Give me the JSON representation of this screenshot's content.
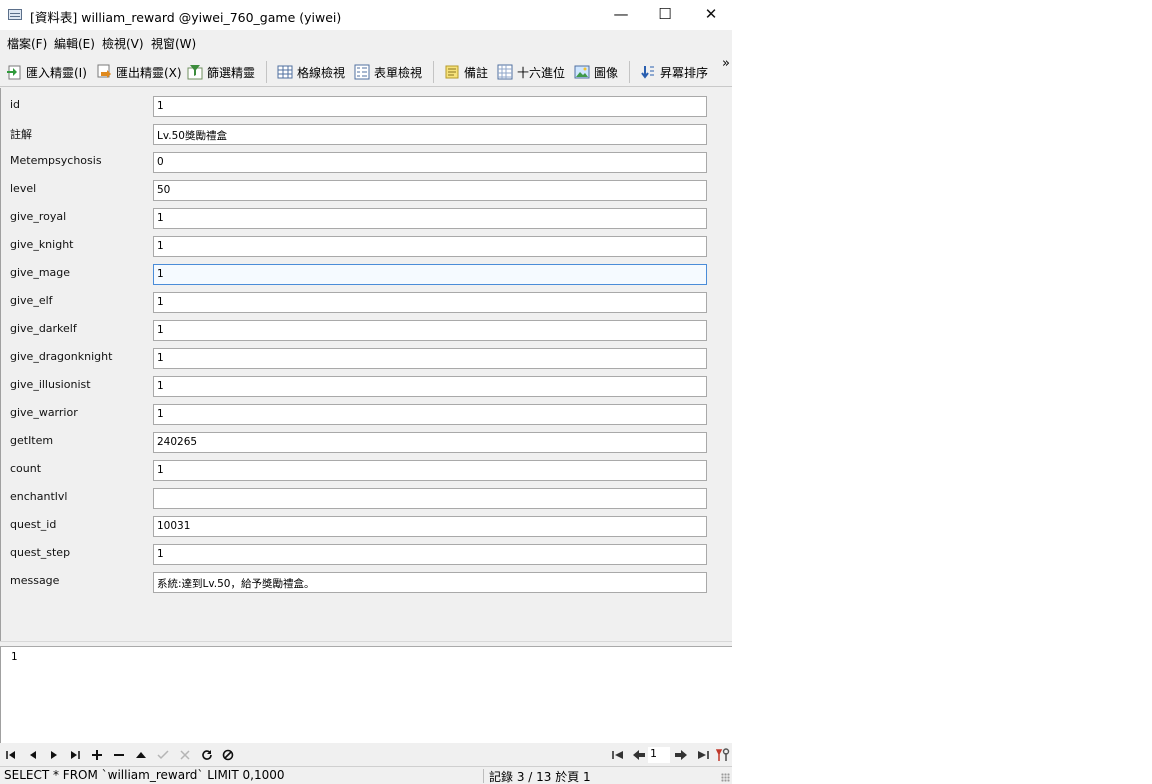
{
  "window": {
    "title": "[資料表] william_reward @yiwei_760_game (yiwei)",
    "buttons": {
      "minimize": "—",
      "maximize": "☐",
      "close": "✕"
    }
  },
  "menu": [
    {
      "label": "檔案(F)"
    },
    {
      "label": "編輯(E)"
    },
    {
      "label": "檢視(V)"
    },
    {
      "label": "視窗(W)"
    }
  ],
  "toolbar": {
    "import_wizard": "匯入精靈(I)",
    "export_wizard": "匯出精靈(X)",
    "filter_wizard": "篩選精靈",
    "grid_view": "格線檢視",
    "form_view": "表單檢視",
    "memo": "備註",
    "hex": "十六進位",
    "image": "圖像",
    "sort_asc": "昇冪排序",
    "more": "»"
  },
  "fields": [
    {
      "label": "id",
      "value": "1"
    },
    {
      "label": "註解",
      "value": "Lv.50獎勵禮盒"
    },
    {
      "label": "Metempsychosis",
      "value": "0"
    },
    {
      "label": "level",
      "value": "50"
    },
    {
      "label": "give_royal",
      "value": "1"
    },
    {
      "label": "give_knight",
      "value": "1"
    },
    {
      "label": "give_mage",
      "value": "1"
    },
    {
      "label": "give_elf",
      "value": "1"
    },
    {
      "label": "give_darkelf",
      "value": "1"
    },
    {
      "label": "give_dragonknight",
      "value": "1"
    },
    {
      "label": "give_illusionist",
      "value": "1"
    },
    {
      "label": "give_warrior",
      "value": "1"
    },
    {
      "label": "getItem",
      "value": "240265"
    },
    {
      "label": "count",
      "value": "1"
    },
    {
      "label": "enchantlvl",
      "value": ""
    },
    {
      "label": "quest_id",
      "value": "10031"
    },
    {
      "label": "quest_step",
      "value": "1"
    },
    {
      "label": "message",
      "value": "系統:達到Lv.50，給予獎勵禮盒。"
    }
  ],
  "focused_field": "give_mage",
  "text_pane": {
    "content": "1"
  },
  "navigator": {
    "page": "1"
  },
  "status": {
    "sql": "SELECT * FROM `william_reward` LIMIT 0,1000",
    "record": "記錄 3 / 13 於頁 1"
  }
}
